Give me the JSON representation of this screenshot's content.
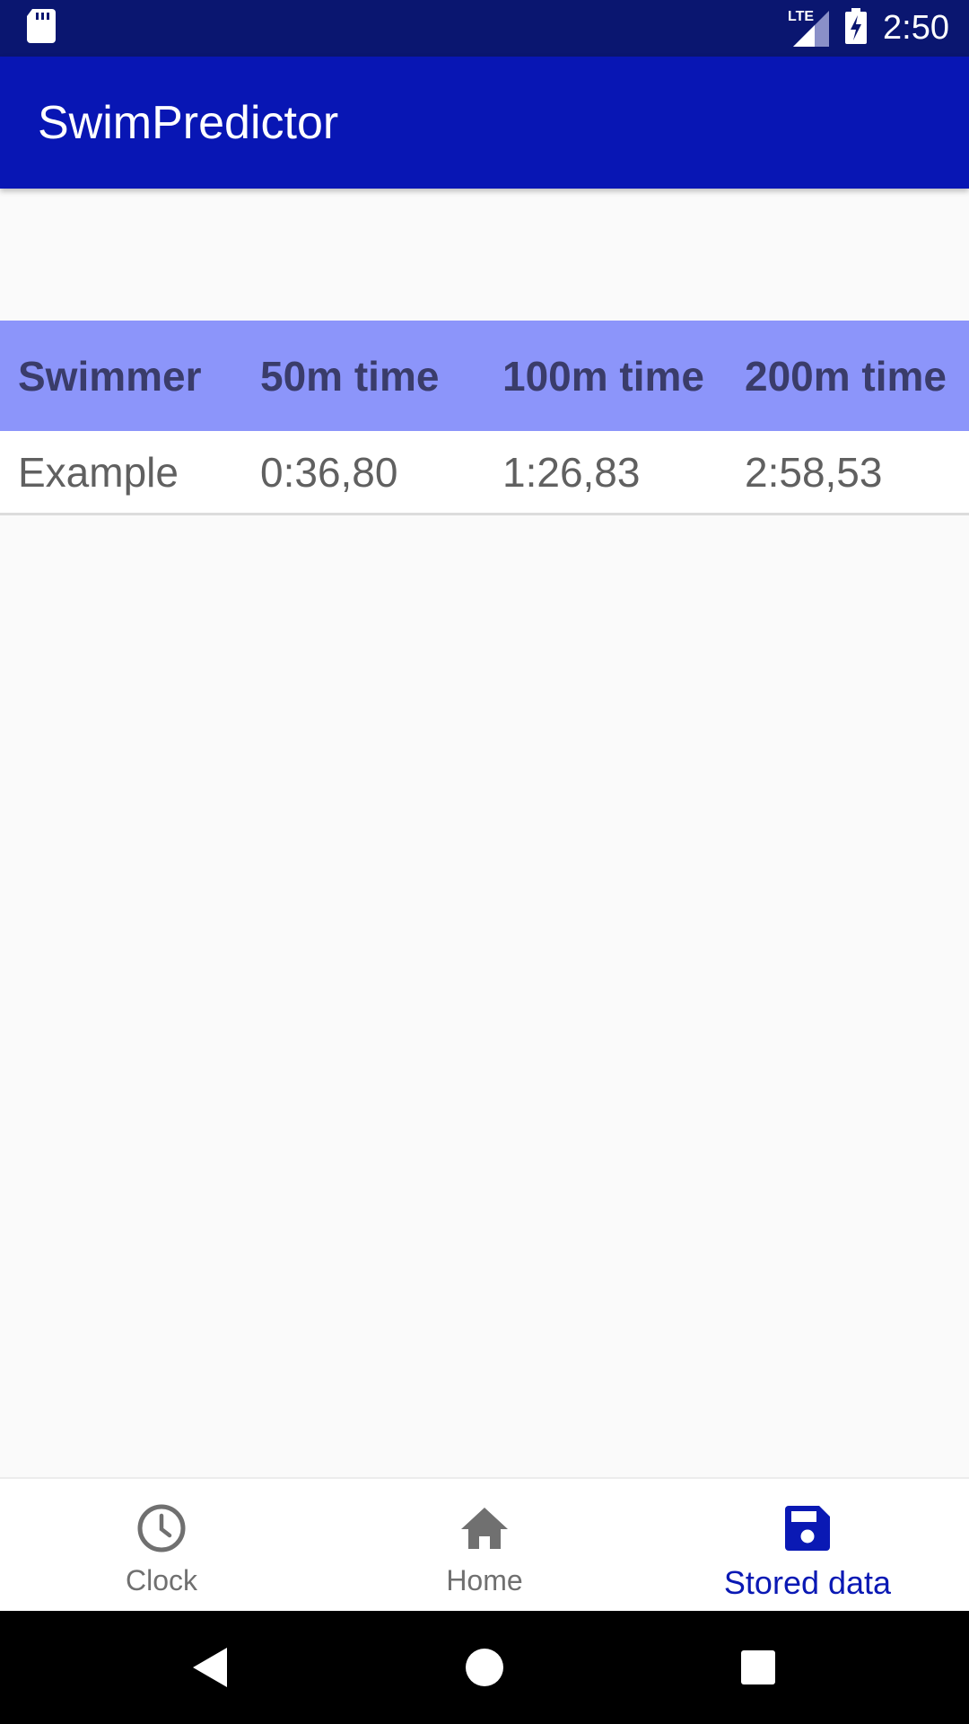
{
  "status_bar": {
    "time": "2:50",
    "network_label": "LTE",
    "icons": [
      "sd-card-icon",
      "signal-icon",
      "battery-charging-icon"
    ]
  },
  "app_bar": {
    "title": "SwimPredictor",
    "color": "#0816b4"
  },
  "table": {
    "header_color": "#8c95fa",
    "columns": [
      "Swimmer",
      "50m time",
      "100m time",
      "200m time"
    ],
    "rows": [
      [
        "Example",
        "0:36,80",
        "1:26,83",
        "2:58,53"
      ]
    ]
  },
  "bottom_nav": {
    "items": [
      {
        "label": "Clock",
        "icon": "clock-icon",
        "active": false
      },
      {
        "label": "Home",
        "icon": "home-icon",
        "active": false
      },
      {
        "label": "Stored data",
        "icon": "save-icon",
        "active": true
      }
    ],
    "active_color": "#0a19b4"
  },
  "system_nav": {
    "buttons": [
      "back-icon",
      "home-circle-icon",
      "recents-icon"
    ]
  }
}
